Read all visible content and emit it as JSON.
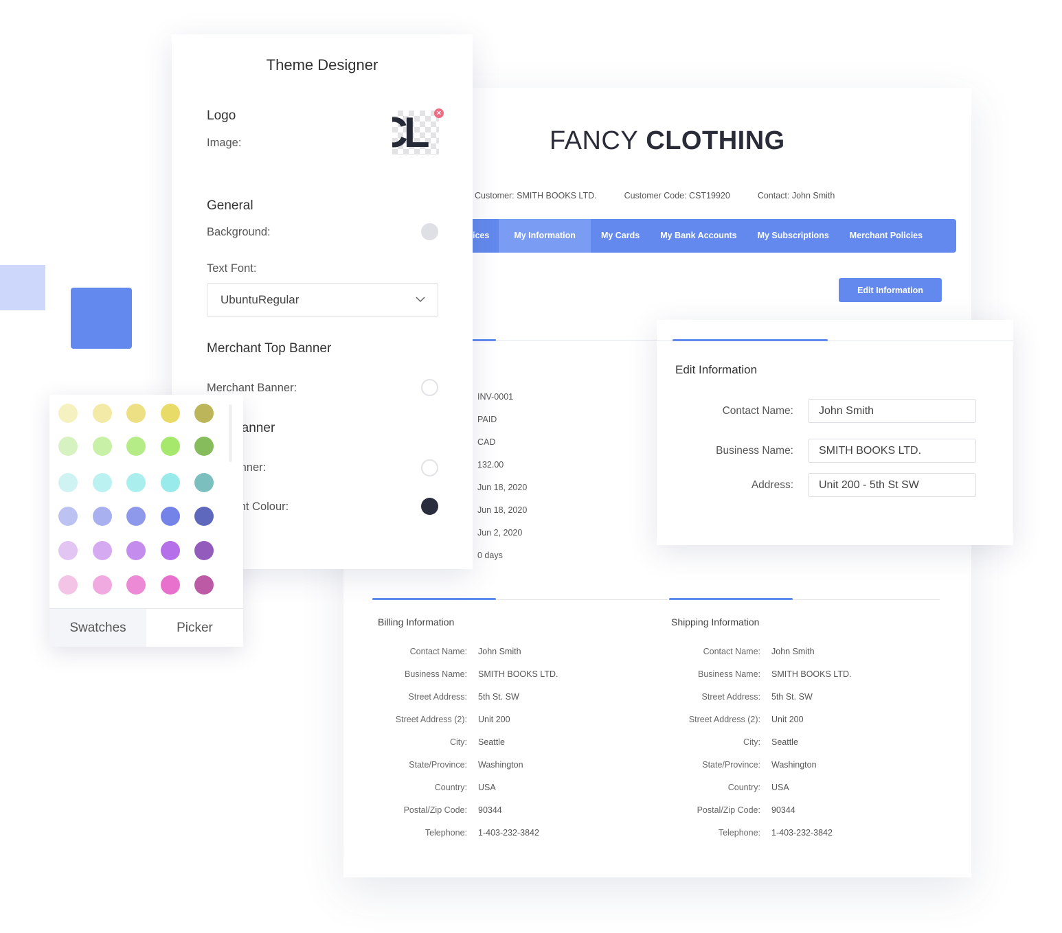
{
  "decor": {
    "accent_color": "#6389ee",
    "accent_light": "#ccd7fb"
  },
  "merchant": {
    "brand_light": "FANCY",
    "brand_bold": "CLOTHING",
    "customer_info": {
      "customer": "Customer: SMITH BOOKS LTD.",
      "customer_code": "Customer Code: CST19920",
      "contact": "Contact: John Smith"
    },
    "nav": [
      {
        "label": "ices",
        "active": false
      },
      {
        "label": "My Information",
        "active": true
      },
      {
        "label": "My Cards",
        "active": false
      },
      {
        "label": "My Bank Accounts",
        "active": false
      },
      {
        "label": "My Subscriptions",
        "active": false
      },
      {
        "label": "Merchant Policies",
        "active": false
      }
    ],
    "edit_button": "Edit Information",
    "invoice_values": [
      "INV-0001",
      "PAID",
      "CAD",
      "132.00",
      "Jun 18, 2020",
      "Jun 18, 2020",
      "Jun 2, 2020",
      "0 days"
    ],
    "billing": {
      "title": "Billing Information",
      "rows": [
        {
          "label": "Contact Name:",
          "value": "John Smith"
        },
        {
          "label": "Business Name:",
          "value": "SMITH BOOKS LTD."
        },
        {
          "label": "Street Address:",
          "value": "5th St. SW"
        },
        {
          "label": "Street Address (2):",
          "value": "Unit 200"
        },
        {
          "label": "City:",
          "value": "Seattle"
        },
        {
          "label": "State/Province:",
          "value": "Washington"
        },
        {
          "label": "Country:",
          "value": "USA"
        },
        {
          "label": "Postal/Zip Code:",
          "value": "90344"
        },
        {
          "label": "Telephone:",
          "value": "1-403-232-3842"
        }
      ]
    },
    "shipping": {
      "title": "Shipping Information",
      "rows": [
        {
          "label": "Contact Name:",
          "value": "John Smith"
        },
        {
          "label": "Business Name:",
          "value": "SMITH BOOKS LTD."
        },
        {
          "label": "Street Address:",
          "value": "5th St. SW"
        },
        {
          "label": "Street Address (2):",
          "value": "Unit 200"
        },
        {
          "label": "City:",
          "value": "Seattle"
        },
        {
          "label": "State/Province:",
          "value": "Washington"
        },
        {
          "label": "Country:",
          "value": "USA"
        },
        {
          "label": "Postal/Zip Code:",
          "value": "90344"
        },
        {
          "label": "Telephone:",
          "value": "1-403-232-3842"
        }
      ]
    }
  },
  "theme_designer": {
    "title": "Theme Designer",
    "logo_heading": "Logo",
    "image_label": "Image:",
    "logo_glyph": "CL",
    "logo_remove_icon": "×",
    "general_heading": "General",
    "background_label": "Background:",
    "background_color": "#dfe0e6",
    "text_font_label": "Text Font:",
    "text_font_value": "UbuntuRegular",
    "merchant_banner_heading": "Merchant Top Banner",
    "merchant_banner_label": "Merchant Banner:",
    "merchant_banner_color": "#ffffff",
    "customer_banner_heading": "mer Banner",
    "customer_banner_label": "ner Banner:",
    "customer_banner_color": "#ffffff",
    "customer_font_label": "ner Font Colour:",
    "customer_font_color": "#2a2d3b"
  },
  "swatch_popover": {
    "rows": [
      [
        "#f5f1c0",
        "#f2eaa6",
        "#ede084",
        "#e9db67",
        "#bdb55a"
      ],
      [
        "#d6f2c0",
        "#c8f0a6",
        "#b5ec87",
        "#a5e86c",
        "#86bc5c"
      ],
      [
        "#cff3f3",
        "#bcf1f1",
        "#aaeeed",
        "#99eaea",
        "#7bbfbf"
      ],
      [
        "#bcc3f3",
        "#a8b0f0",
        "#8e99ec",
        "#7483e8",
        "#5e68bc"
      ],
      [
        "#e3c5f3",
        "#d6aaf0",
        "#c48cec",
        "#b56fe8",
        "#935bbc"
      ],
      [
        "#f4c4e7",
        "#f0aae0",
        "#ec8ad5",
        "#e871cd",
        "#bc5aa6"
      ]
    ],
    "tabs": [
      {
        "label": "Swatches",
        "active": true
      },
      {
        "label": "Picker",
        "active": false
      }
    ]
  },
  "edit_info": {
    "title": "Edit Information",
    "fields": [
      {
        "label": "Contact Name:",
        "value": "John Smith"
      },
      {
        "label": "Business Name:",
        "value": "SMITH BOOKS LTD."
      },
      {
        "label": "Address:",
        "value": "Unit 200 - 5th St SW"
      }
    ]
  }
}
